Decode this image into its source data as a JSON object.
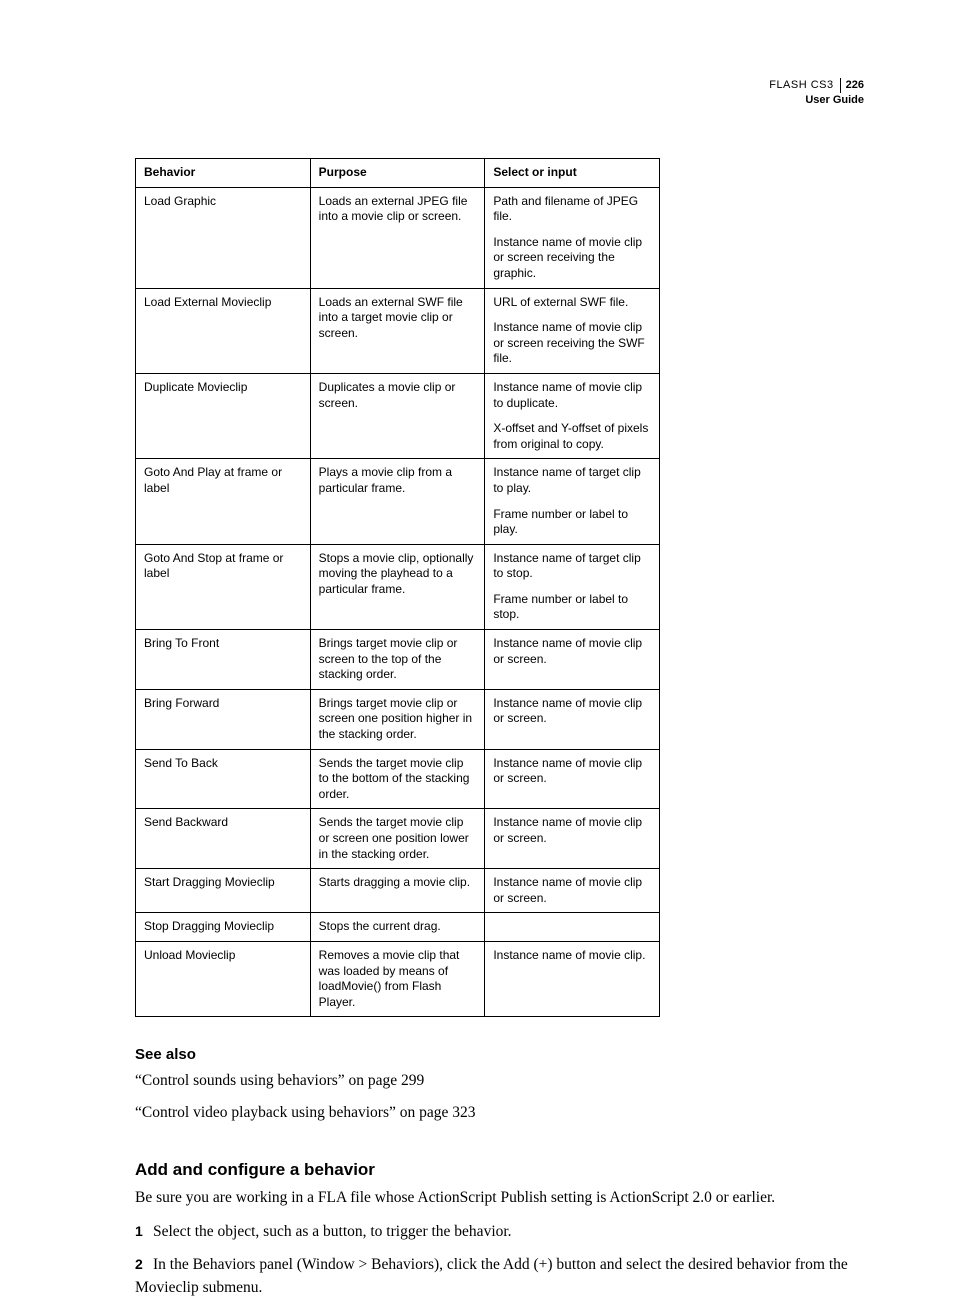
{
  "header": {
    "product": "FLASH CS3",
    "page_number": "226",
    "guide": "User Guide"
  },
  "table": {
    "headers": [
      "Behavior",
      "Purpose",
      "Select or input"
    ],
    "rows": [
      {
        "behavior": "Load Graphic",
        "purpose": "Loads an external JPEG file into a movie clip or screen.",
        "select": [
          "Path and filename of JPEG file.",
          "Instance name of movie clip or screen receiving the graphic."
        ]
      },
      {
        "behavior": "Load External Movieclip",
        "purpose": "Loads an external SWF file into a target movie clip or screen.",
        "select": [
          "URL of external SWF file.",
          "Instance name of movie clip or screen receiving the SWF file."
        ]
      },
      {
        "behavior": "Duplicate Movieclip",
        "purpose": "Duplicates a movie clip or screen.",
        "select": [
          "Instance name of movie clip to duplicate.",
          "X-offset and Y-offset of pixels from original to copy."
        ]
      },
      {
        "behavior": "Goto And Play at frame or label",
        "purpose": "Plays a movie clip from a particular frame.",
        "select": [
          "Instance name of target clip to play.",
          "Frame number or label to play."
        ]
      },
      {
        "behavior": "Goto And Stop at frame or label",
        "purpose": "Stops a movie clip, optionally moving the playhead to a particular frame.",
        "select": [
          "Instance name of target clip to stop.",
          "Frame number or label to stop."
        ]
      },
      {
        "behavior": "Bring To Front",
        "purpose": "Brings target movie clip or screen to the top of the stacking order.",
        "select": [
          "Instance name of movie clip or screen."
        ]
      },
      {
        "behavior": "Bring Forward",
        "purpose": "Brings target movie clip or screen one position higher in the stacking order.",
        "select": [
          "Instance name of movie clip or screen."
        ]
      },
      {
        "behavior": "Send To Back",
        "purpose": "Sends the target movie clip to the bottom of the stacking order.",
        "select": [
          "Instance name of movie clip or screen."
        ]
      },
      {
        "behavior": "Send Backward",
        "purpose": "Sends the target movie clip or screen one position lower in the stacking order.",
        "select": [
          "Instance name of movie clip or screen."
        ]
      },
      {
        "behavior": "Start Dragging Movieclip",
        "purpose": "Starts dragging a movie clip.",
        "select": [
          "Instance name of movie clip or screen."
        ]
      },
      {
        "behavior": "Stop Dragging Movieclip",
        "purpose": "Stops the current drag.",
        "select": []
      },
      {
        "behavior": "Unload Movieclip",
        "purpose": "Removes a movie clip that was loaded by means of loadMovie() from Flash Player.",
        "select": [
          "Instance name of movie clip."
        ]
      }
    ]
  },
  "see_also": {
    "heading": "See also",
    "links": [
      "“Control sounds using behaviors” on page 299",
      "“Control video playback using behaviors” on page 323"
    ]
  },
  "procedure": {
    "heading": "Add and configure a behavior",
    "intro": "Be sure you are working in a FLA file whose ActionScript Publish setting is ActionScript 2.0 or earlier.",
    "steps": [
      "Select the object, such as a button, to trigger the behavior.",
      "In the Behaviors panel (Window > Behaviors), click the Add (+) button and select the desired behavior from the Movieclip submenu."
    ],
    "step_numbers": [
      "1",
      "2"
    ]
  }
}
